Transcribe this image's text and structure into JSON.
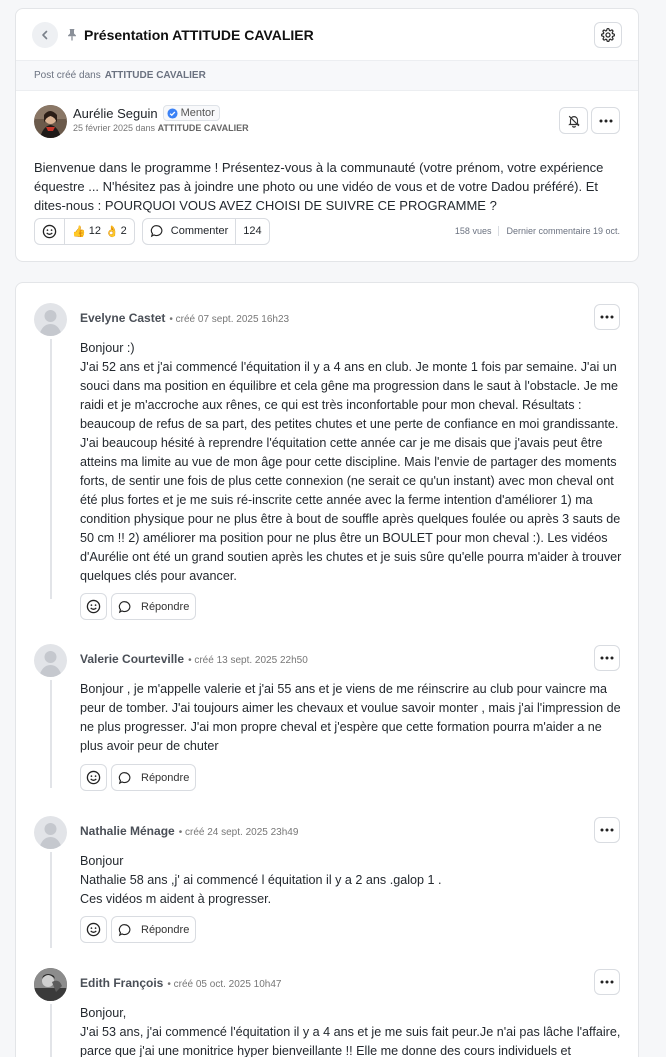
{
  "header": {
    "title": "Présentation ATTITUDE CAVALIER",
    "breadcrumb_prefix": "Post créé dans",
    "breadcrumb_space": "ATTITUDE CAVALIER"
  },
  "post": {
    "author_name": "Aurélie Seguin",
    "badge": "Mentor",
    "date": "25 février 2025 dans",
    "space": "ATTITUDE CAVALIER",
    "body": "Bienvenue dans le programme ! Présentez-vous à la communauté (votre prénom, votre expérience équestre ... N'hésitez pas à joindre une photo ou une vidéo de vous et de votre Dadou préféré). Et dites-nous : POURQUOI VOUS AVEZ CHOISI DE SUIVRE CE PROGRAMME ?",
    "reactions": [
      {
        "emoji": "👍",
        "count": "12"
      },
      {
        "emoji": "👌",
        "count": "2"
      }
    ],
    "comment_label": "Commenter",
    "comment_count": "124",
    "views": "158 vues",
    "last_comment": "Dernier commentaire 19 oct."
  },
  "comments": [
    {
      "name": "Evelyne Castet",
      "date": "• créé 07 sept. 2025 16h23",
      "text": "Bonjour :)\nJ'ai 52 ans et j'ai commencé l'équitation il y a 4 ans en club. Je monte 1 fois par semaine. J'ai un souci dans ma position en équilibre et cela gêne ma progression dans le saut à l'obstacle. Je me raidi et je m'accroche aux rênes, ce qui est très inconfortable pour mon cheval. Résultats : beaucoup de refus de sa part, des petites chutes et une perte de confiance en moi grandissante. J'ai beaucoup hésité à reprendre l'équitation cette année car je me disais que j'avais peut être atteins ma limite au vue de mon âge pour cette discipline. Mais l'envie de partager des moments forts, de sentir une fois de plus cette connexion (ne serait ce qu'un instant) avec mon cheval ont été plus fortes et je me suis ré-inscrite cette année avec la ferme intention d'améliorer 1) ma condition physique pour ne plus être à bout de souffle après quelques foulée ou après 3 sauts de 50 cm !! 2) améliorer ma position pour ne plus être un BOULET pour mon cheval :). Les vidéos d'Aurélie ont été un grand soutien après les chutes et je suis sûre qu'elle pourra m'aider à trouver quelques clés pour avancer.",
      "reply": "Répondre"
    },
    {
      "name": "Valerie Courteville",
      "date": "• créé 13 sept. 2025 22h50",
      "text": "Bonjour , je m'appelle valerie et j'ai 55 ans et je viens de me réinscrire au club pour vaincre ma peur de  tomber. J'ai toujours aimer les chevaux  et voulue savoir monter , mais j'ai l'impression de ne plus progresser. J'ai mon propre cheval et j'espère que cette formation pourra m'aider a ne plus avoir peur de chuter",
      "reply": "Répondre"
    },
    {
      "name": "Nathalie Ménage",
      "date": "• créé 24 sept. 2025 23h49",
      "text": "Bonjour\nNathalie 58 ans ,j' ai commencé l équitation il y a 2 ans .galop 1 .\nCes vidéos m aident à progresser.",
      "reply": "Répondre"
    },
    {
      "name": "Edith François",
      "date": "• créé 05 oct. 2025 10h47",
      "text": "Bonjour,\nJ'ai 53 ans, j'ai commencé l'équitation il y a 4 ans et je me suis fait peur.Je n'ai pas lâche l'affaire, parce que j'ai une monitrice hyper bienveillante !! Elle me donne des cours individuels et",
      "reply": "Répondre"
    }
  ]
}
